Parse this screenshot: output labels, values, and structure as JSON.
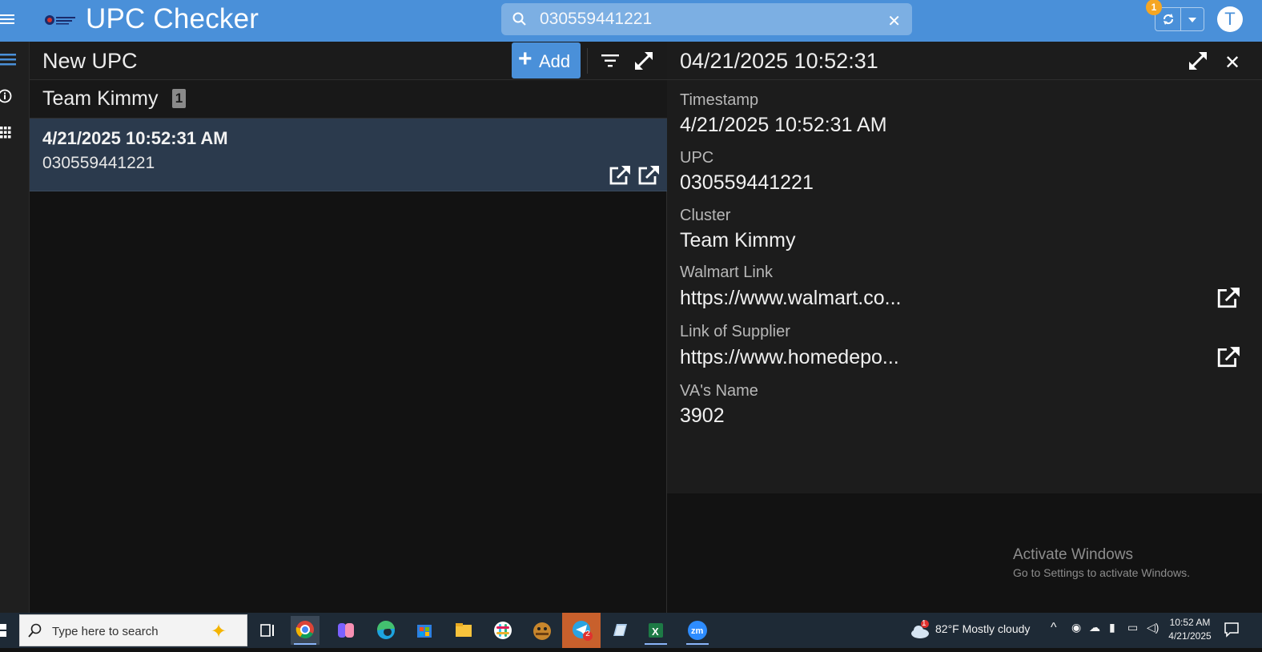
{
  "app": {
    "title": "UPC Checker"
  },
  "search": {
    "value": "030559441221",
    "placeholder": ""
  },
  "header": {
    "sync_badge": "1",
    "avatar_letter": "T"
  },
  "list": {
    "title": "New UPC",
    "add_label": "Add",
    "group": {
      "title": "Team Kimmy",
      "count": "1"
    },
    "rows": [
      {
        "timestamp": "4/21/2025 10:52:31 AM",
        "upc": "030559441221"
      }
    ]
  },
  "detail": {
    "title": "04/21/2025 10:52:31",
    "fields": [
      {
        "label": "Timestamp",
        "value": "4/21/2025 10:52:31 AM"
      },
      {
        "label": "UPC",
        "value": "030559441221"
      },
      {
        "label": "Cluster",
        "value": "Team Kimmy"
      },
      {
        "label": "Walmart Link",
        "value": "https://www.walmart.co..."
      },
      {
        "label": "Link of Supplier",
        "value": "https://www.homedepo..."
      },
      {
        "label": "VA's Name",
        "value": "3902"
      }
    ]
  },
  "watermark": {
    "line1": "Activate Windows",
    "line2": "Go to Settings to activate Windows."
  },
  "taskbar": {
    "search_placeholder": "Type here to search",
    "telegram_badge": "2",
    "weather_badge": "1",
    "weather": "82°F  Mostly cloudy",
    "time": "10:52 AM",
    "date": "4/21/2025"
  },
  "colors": {
    "appbar": "#4a90d9",
    "selected_row": "#2b3a4d",
    "badge": "#f5a623"
  }
}
